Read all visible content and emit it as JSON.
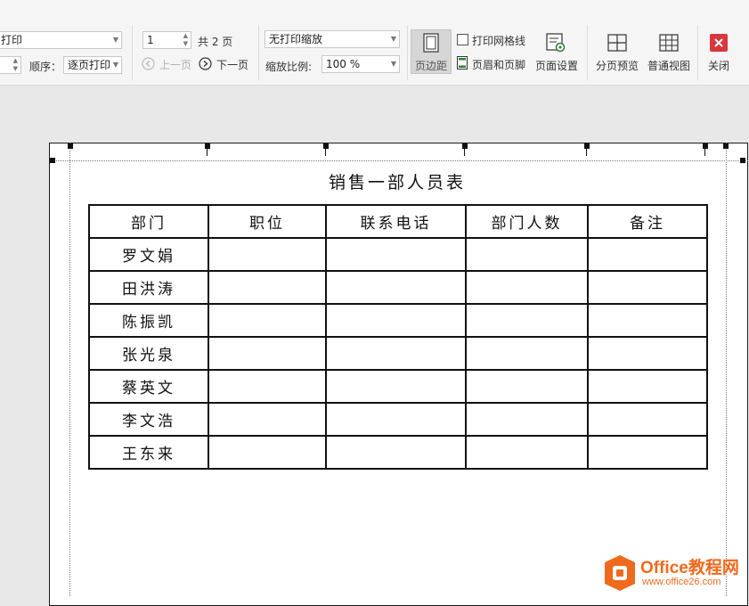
{
  "toolbar": {
    "print_mode_select": "打印",
    "order_label": "顺序：",
    "order_select": "逐页打印",
    "page_input": "1",
    "total_pages": "共 2 页",
    "prev_page": "上一页",
    "next_page": "下一页",
    "scale_select": "无打印缩放",
    "zoom_label": "缩放比例:",
    "zoom_select": "100 %",
    "margins_label": "页边距",
    "gridlines_label": "打印网格线",
    "header_footer_label": "页眉和页脚",
    "page_setup_label": "页面设置",
    "page_break_preview_label": "分页预览",
    "normal_view_label": "普通视图",
    "close_label": "关闭"
  },
  "sheet": {
    "title": "销售一部人员表",
    "headers": [
      "部门",
      "职位",
      "联系电话",
      "部门人数",
      "备注"
    ],
    "rows": [
      [
        "罗文娟",
        "",
        "",
        "",
        ""
      ],
      [
        "田洪涛",
        "",
        "",
        "",
        ""
      ],
      [
        "陈振凯",
        "",
        "",
        "",
        ""
      ],
      [
        "张光泉",
        "",
        "",
        "",
        ""
      ],
      [
        "蔡英文",
        "",
        "",
        "",
        ""
      ],
      [
        "李文浩",
        "",
        "",
        "",
        ""
      ],
      [
        "王东来",
        "",
        "",
        "",
        ""
      ]
    ]
  },
  "watermark": {
    "brand": "Office教程网",
    "url": "www.office26.com"
  },
  "colors": {
    "accent_orange": "#f06a1d",
    "close_red": "#d9363e",
    "active_button_bg": "#d6d6d6"
  }
}
